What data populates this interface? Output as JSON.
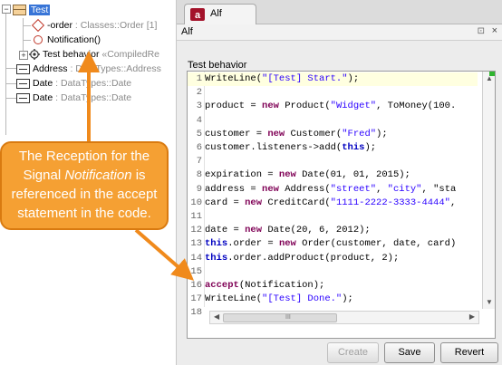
{
  "tree": {
    "class_name": "Test",
    "attr_order": {
      "name": "-order",
      "type": " : Classes::Order [1]"
    },
    "reception": "Notification()",
    "behavior": {
      "name": "Test behavior",
      "type": " «CompiledRe"
    },
    "attr_address": {
      "name": "Address",
      "type": " : DataTypes::Address"
    },
    "attr_date1": {
      "name": "Date",
      "type": " : DataTypes::Date"
    },
    "attr_date2": {
      "name": "Date",
      "type": " : DataTypes::Date"
    }
  },
  "editor": {
    "tab_label": "Alf",
    "title": "Alf",
    "pin_symbol": "⊡",
    "close_symbol": "×",
    "section_label": "Test behavior",
    "code": [
      {
        "n": "1",
        "t": "WriteLine(\"[Test] Start.\");"
      },
      {
        "n": "2",
        "t": ""
      },
      {
        "n": "3",
        "t": "product = new Product(\"Widget\", ToMoney(100."
      },
      {
        "n": "4",
        "t": ""
      },
      {
        "n": "5",
        "t": "customer = new Customer(\"Fred\");"
      },
      {
        "n": "6",
        "t": "customer.listeners->add(this);"
      },
      {
        "n": "7",
        "t": ""
      },
      {
        "n": "8",
        "t": "expiration = new Date(01, 01, 2015);"
      },
      {
        "n": "9",
        "t": "address = new Address(\"street\", \"city\", \"sta"
      },
      {
        "n": "10",
        "t": "card = new CreditCard(\"1111-2222-3333-4444\","
      },
      {
        "n": "11",
        "t": ""
      },
      {
        "n": "12",
        "t": "date = new Date(20, 6, 2012);"
      },
      {
        "n": "13",
        "t": "this.order = new Order(customer, date, card)"
      },
      {
        "n": "14",
        "t": "this.order.addProduct(product, 2);"
      },
      {
        "n": "15",
        "t": ""
      },
      {
        "n": "16",
        "t": "accept(Notification);"
      },
      {
        "n": "17",
        "t": "WriteLine(\"[Test] Done.\");"
      },
      {
        "n": "18",
        "t": ""
      }
    ],
    "scroll_grip": "III",
    "buttons": {
      "create": "Create",
      "save": "Save",
      "revert": "Revert"
    }
  },
  "callout": {
    "line1": "The Reception for the",
    "line2_pre": "Signal ",
    "line2_italic": "Notification",
    "line2_post": " is",
    "line3": "referenced  in the accept",
    "line4": "statement in the code."
  },
  "colors": {
    "callout_fill": "#f5a033",
    "arrow": "#f08a1c",
    "keyword": "#7f0055",
    "string": "#2a00ff",
    "selection": "#3875d7"
  }
}
